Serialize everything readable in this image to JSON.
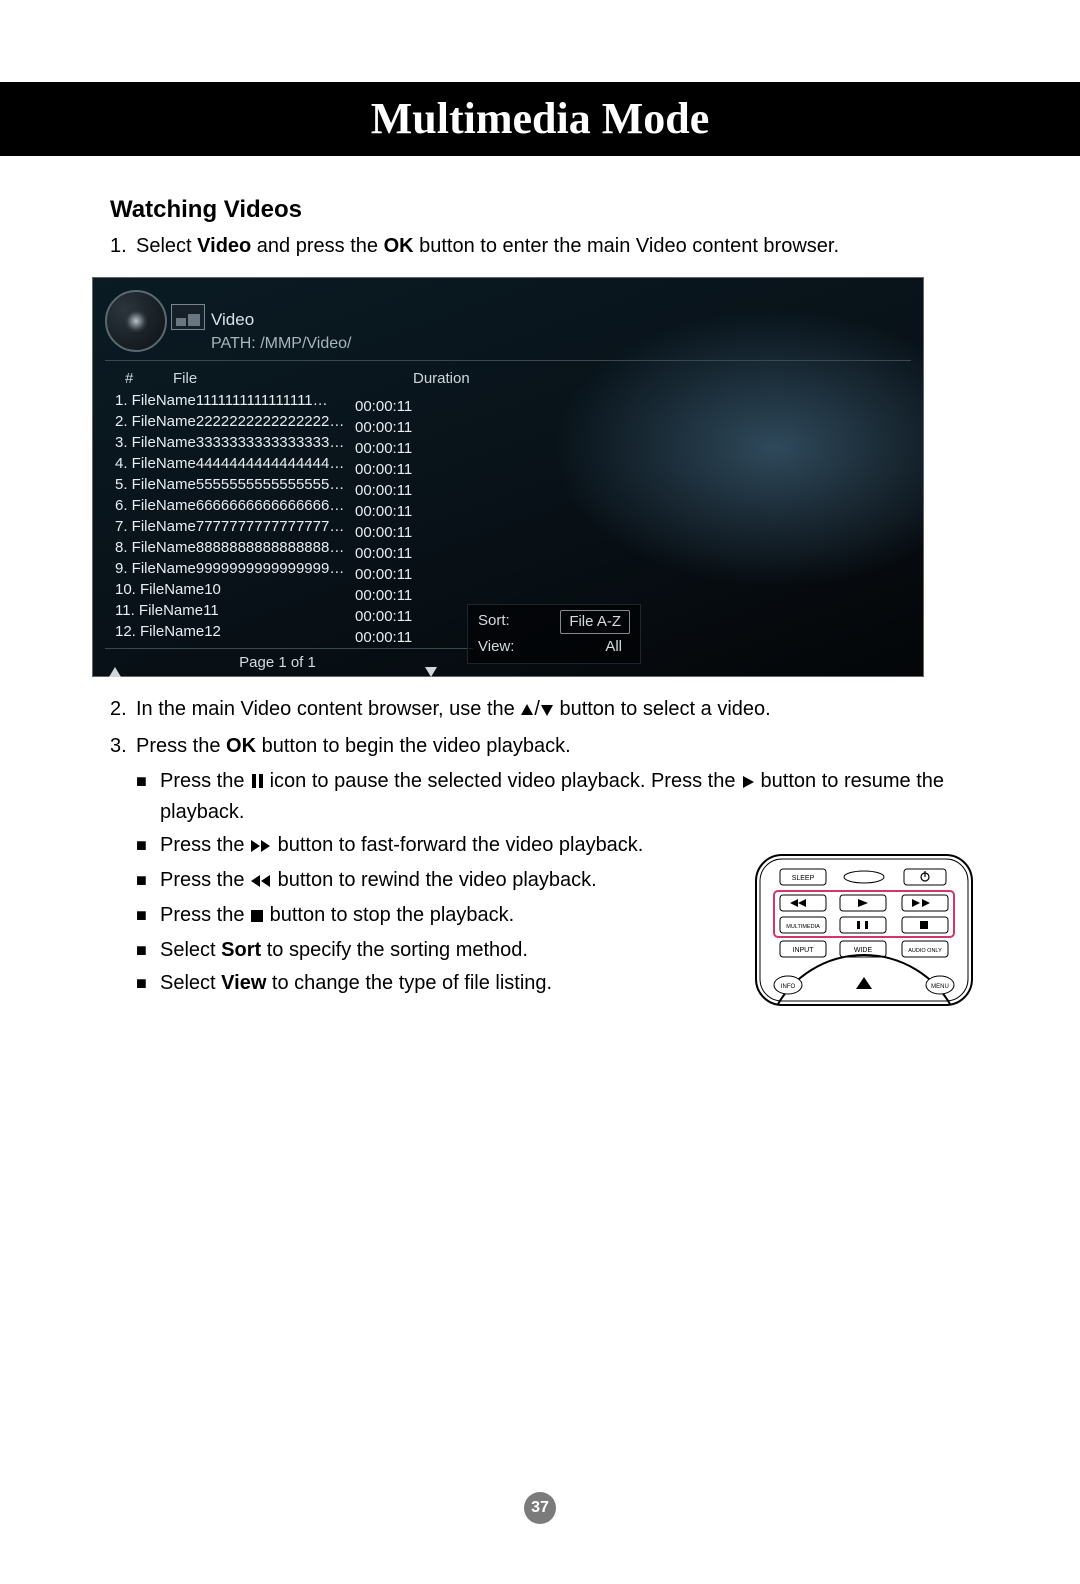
{
  "header": {
    "title": "Multimedia Mode"
  },
  "section": {
    "heading": "Watching Videos"
  },
  "steps": {
    "s1_pre": "Select ",
    "s1_b1": "Video",
    "s1_mid": " and press the ",
    "s1_b2": "OK",
    "s1_post": " button to enter the main Video content browser.",
    "s2_pre": "In the main Video content browser, use the ",
    "s2_post": " button to select a video.",
    "s3_pre": "Press the ",
    "s3_b": "OK",
    "s3_post": " button to begin the video playback."
  },
  "bullets": {
    "b1_pre": "Press the ",
    "b1_mid": " icon to pause the selected video playback. Press the ",
    "b1_post": " button to resume the playback.",
    "b2_pre": "Press the ",
    "b2_post": " button to fast-forward the video playback.",
    "b3_pre": "Press the ",
    "b3_post": " button to rewind the video playback.",
    "b4_pre": "Press the ",
    "b4_post": " button to stop the playback.",
    "b5_pre": "Select ",
    "b5_b": "Sort",
    "b5_post": " to specify the sorting method.",
    "b6_pre": "Select ",
    "b6_b": "View",
    "b6_post": " to change the type of file listing."
  },
  "screenshot": {
    "title": "Video",
    "path": "PATH: /MMP/Video/",
    "col_hash": "#",
    "col_file": "File",
    "col_duration": "Duration",
    "files": [
      {
        "idx": "1.",
        "name": "FileName1111111111111111…",
        "dur": "00:00:11"
      },
      {
        "idx": "2.",
        "name": "FileName2222222222222222…",
        "dur": "00:00:11"
      },
      {
        "idx": "3.",
        "name": "FileName3333333333333333…",
        "dur": "00:00:11"
      },
      {
        "idx": "4.",
        "name": "FileName4444444444444444…",
        "dur": "00:00:11"
      },
      {
        "idx": "5.",
        "name": "FileName5555555555555555…",
        "dur": "00:00:11"
      },
      {
        "idx": "6.",
        "name": "FileName6666666666666666…",
        "dur": "00:00:11"
      },
      {
        "idx": "7.",
        "name": "FileName7777777777777777…",
        "dur": "00:00:11"
      },
      {
        "idx": "8.",
        "name": "FileName8888888888888888…",
        "dur": "00:00:11"
      },
      {
        "idx": "9.",
        "name": "FileName9999999999999999…",
        "dur": "00:00:11"
      },
      {
        "idx": "10.",
        "name": "FileName10",
        "dur": "00:00:11"
      },
      {
        "idx": "11.",
        "name": "FileName11",
        "dur": "00:00:11"
      },
      {
        "idx": "12.",
        "name": "FileName12",
        "dur": "00:00:11"
      }
    ],
    "pager": "Page 1 of 1",
    "sort_label": "Sort:",
    "sort_value": "File A-Z",
    "view_label": "View:",
    "view_value": "All"
  },
  "remote": {
    "sleep": "SLEEP",
    "multimedia": "MULTIMEDIA",
    "input": "INPUT",
    "wide": "WIDE",
    "audio_only": "AUDIO ONLY",
    "info": "INFO",
    "menu": "MENU"
  },
  "page_number": "37"
}
